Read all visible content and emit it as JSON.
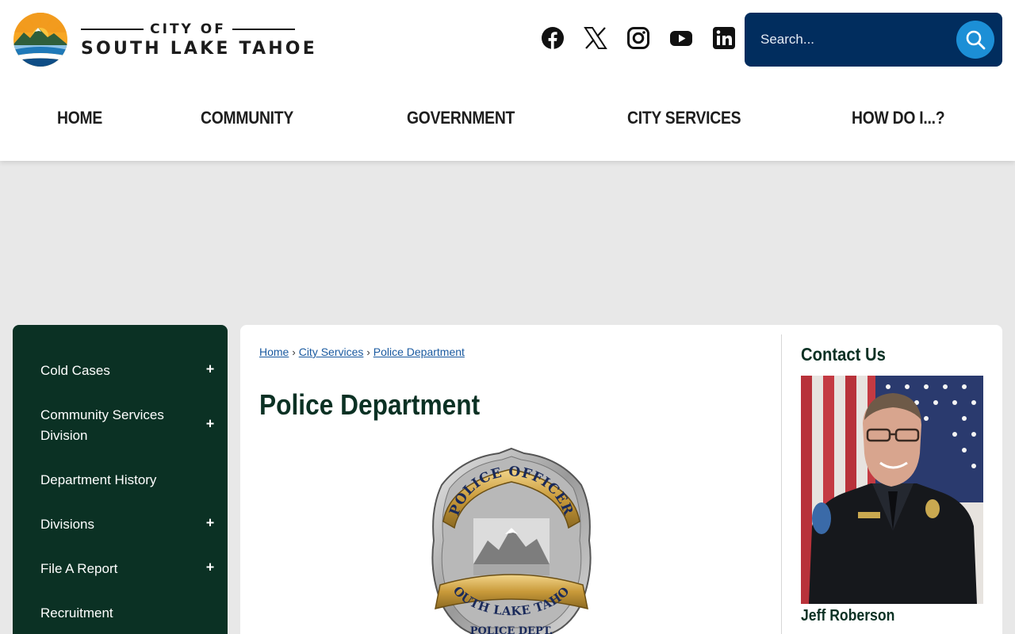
{
  "site": {
    "logo_top": "CITY OF",
    "logo_bottom": "SOUTH LAKE TAHOE"
  },
  "social": [
    {
      "name": "facebook-icon"
    },
    {
      "name": "x-icon"
    },
    {
      "name": "instagram-icon"
    },
    {
      "name": "youtube-icon"
    },
    {
      "name": "linkedin-icon"
    }
  ],
  "search": {
    "placeholder": "Search..."
  },
  "nav": {
    "items": [
      {
        "label": "HOME"
      },
      {
        "label": "COMMUNITY"
      },
      {
        "label": "GOVERNMENT"
      },
      {
        "label": "CITY SERVICES"
      },
      {
        "label": "HOW DO I...?"
      }
    ]
  },
  "sidebar": {
    "items": [
      {
        "label": "Cold Cases",
        "expand": "+"
      },
      {
        "label": "Community Services Division",
        "expand": "+"
      },
      {
        "label": "Department History",
        "expand": ""
      },
      {
        "label": "Divisions",
        "expand": "+"
      },
      {
        "label": "File A Report",
        "expand": "+"
      },
      {
        "label": "Recruitment",
        "expand": ""
      }
    ]
  },
  "breadcrumb": {
    "home": "Home",
    "services": "City Services",
    "current": "Police Department",
    "separator": "›"
  },
  "main": {
    "title": "Police Department",
    "badge_top": "POLICE OFFICER",
    "badge_bottom": "SOUTH LAKE TAHOE",
    "badge_dept": "POLICE DEPT."
  },
  "contact": {
    "title": "Contact Us",
    "name": "Jeff Roberson"
  },
  "colors": {
    "sidebar_bg": "#0b3124",
    "search_bg": "#012d5e",
    "search_button": "#1c8fd6",
    "page_bg": "#e8e8e8"
  }
}
